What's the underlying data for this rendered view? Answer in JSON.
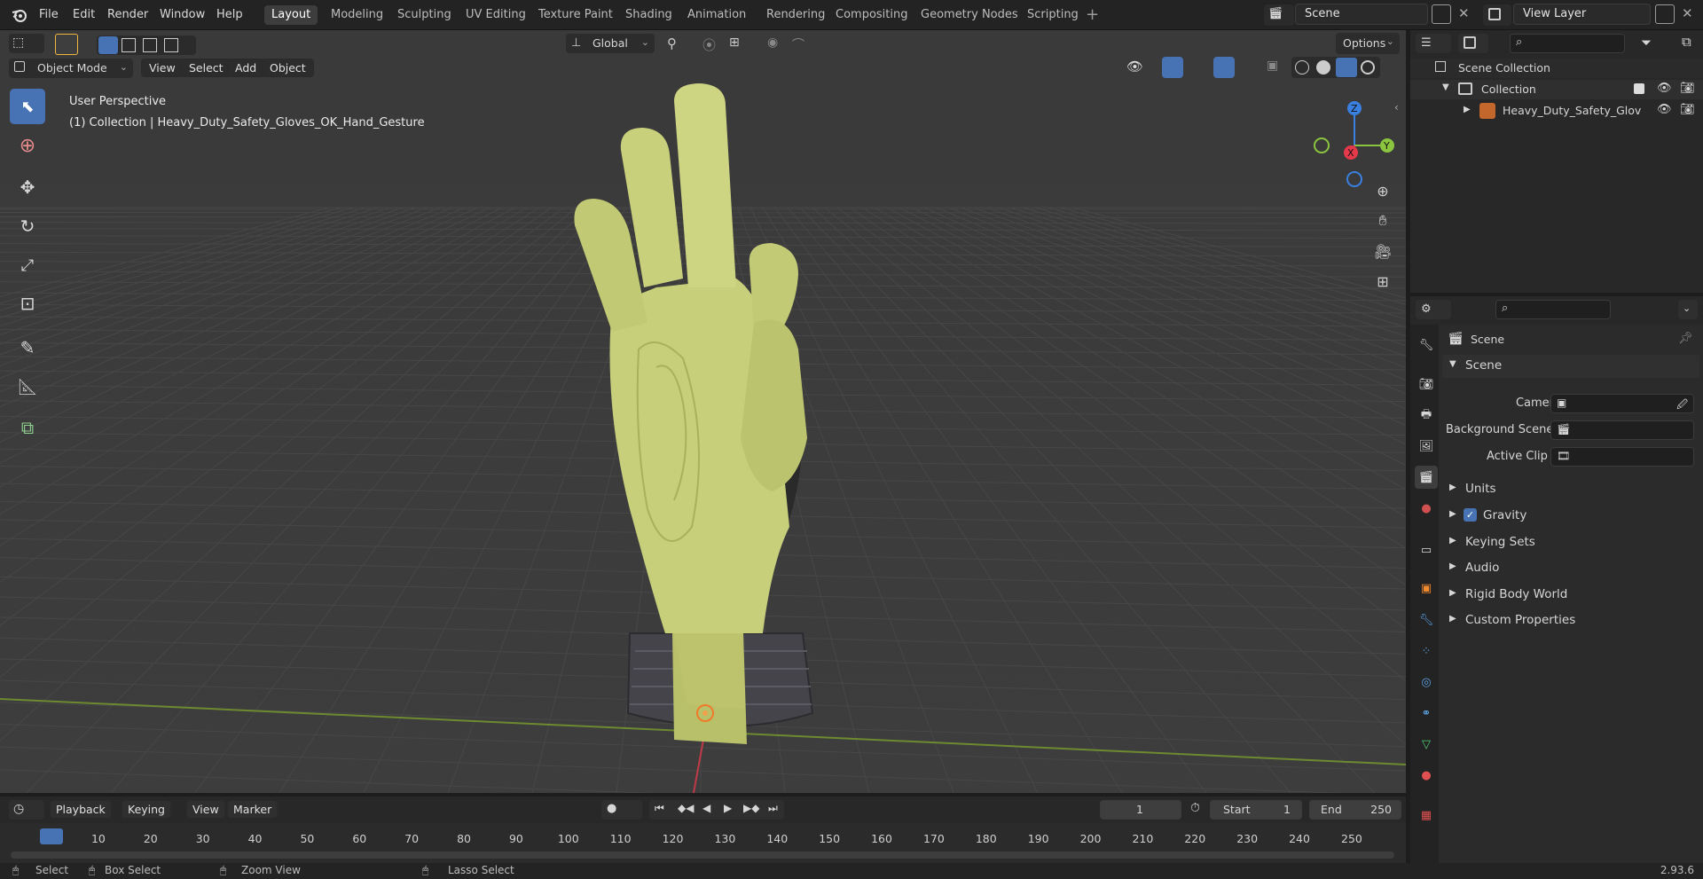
{
  "app": {
    "version": "2.93.6"
  },
  "menubar": {
    "file": "File",
    "edit": "Edit",
    "render": "Render",
    "window": "Window",
    "help": "Help",
    "scene_value": "Scene",
    "view_layer_value": "View Layer"
  },
  "workspaces": [
    {
      "label": "Layout"
    },
    {
      "label": "Modeling"
    },
    {
      "label": "Sculpting"
    },
    {
      "label": "UV Editing"
    },
    {
      "label": "Texture Paint"
    },
    {
      "label": "Shading"
    },
    {
      "label": "Animation"
    },
    {
      "label": "Rendering"
    },
    {
      "label": "Compositing"
    },
    {
      "label": "Geometry Nodes"
    },
    {
      "label": "Scripting"
    }
  ],
  "viewport": {
    "transform_orientation": "Global",
    "options_label": "Options",
    "mode": "Object Mode",
    "menu": {
      "view": "View",
      "select": "Select",
      "add": "Add",
      "object": "Object"
    },
    "overlay_title": "User Perspective",
    "overlay_subtitle": "(1) Collection | Heavy_Duty_Safety_Gloves_OK_Hand_Gesture",
    "axes": {
      "x": "X",
      "y": "Y",
      "z": "Z"
    }
  },
  "outliner": {
    "root": "Scene Collection",
    "collection": "Collection",
    "object": "Heavy_Duty_Safety_Glov"
  },
  "properties": {
    "context_title": "Scene",
    "panel_title": "Scene",
    "camera_label": "Camera",
    "background_scene_label": "Background Scene",
    "active_clip_label": "Active Clip",
    "panels": [
      "Units",
      "Gravity",
      "Keying Sets",
      "Audio",
      "Rigid Body World",
      "Custom Properties"
    ],
    "gravity_checked": true
  },
  "timeline": {
    "menu": {
      "playback": "Playback",
      "keying": "Keying",
      "view": "View",
      "marker": "Marker"
    },
    "current_frame": "1",
    "start_label": "Start",
    "start_value": "1",
    "end_label": "End",
    "end_value": "250",
    "ruler": [
      "1",
      "10",
      "20",
      "30",
      "40",
      "50",
      "60",
      "70",
      "80",
      "90",
      "100",
      "110",
      "120",
      "130",
      "140",
      "150",
      "160",
      "170",
      "180",
      "190",
      "200",
      "210",
      "220",
      "230",
      "240",
      "250"
    ]
  },
  "statusbar": {
    "select": "Select",
    "box_select": "Box Select",
    "zoom_view": "Zoom View",
    "lasso_select": "Lasso Select"
  },
  "colors": {
    "accent": "#4772b3",
    "x_axis": "#e3394b",
    "y_axis": "#8bc53f",
    "z_axis": "#3a80e0",
    "glove_yellow": "#c7cf7a"
  }
}
